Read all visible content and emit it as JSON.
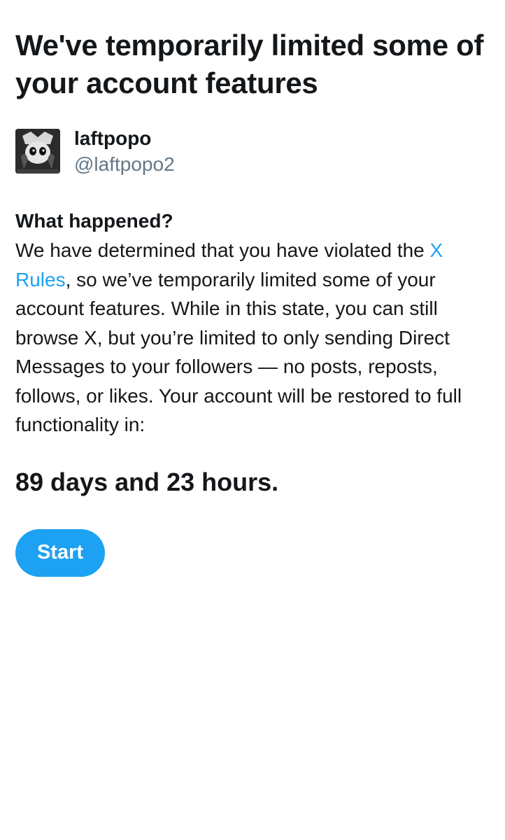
{
  "page": {
    "title": "We've temporarily limited some of your account features"
  },
  "account": {
    "display_name": "laftpopo",
    "handle": "@laftpopo2",
    "avatar_icon": "profile-avatar"
  },
  "notice": {
    "heading": "What happened?",
    "text_before_link": "We have determined that you have violated the ",
    "link_label": "X Rules",
    "text_after_link": ", so we’ve temporarily limited some of your account features. While in this state, you can still browse X, but you’re limited to only sending Direct Messages to your followers — no posts, reposts, follows, or likes. Your account will be restored to full functionality in:",
    "countdown": "89 days and 23 hours."
  },
  "actions": {
    "start_label": "Start"
  },
  "colors": {
    "accent": "#1da1f2",
    "text_primary": "#14171a",
    "text_secondary": "#657786",
    "background": "#ffffff"
  }
}
